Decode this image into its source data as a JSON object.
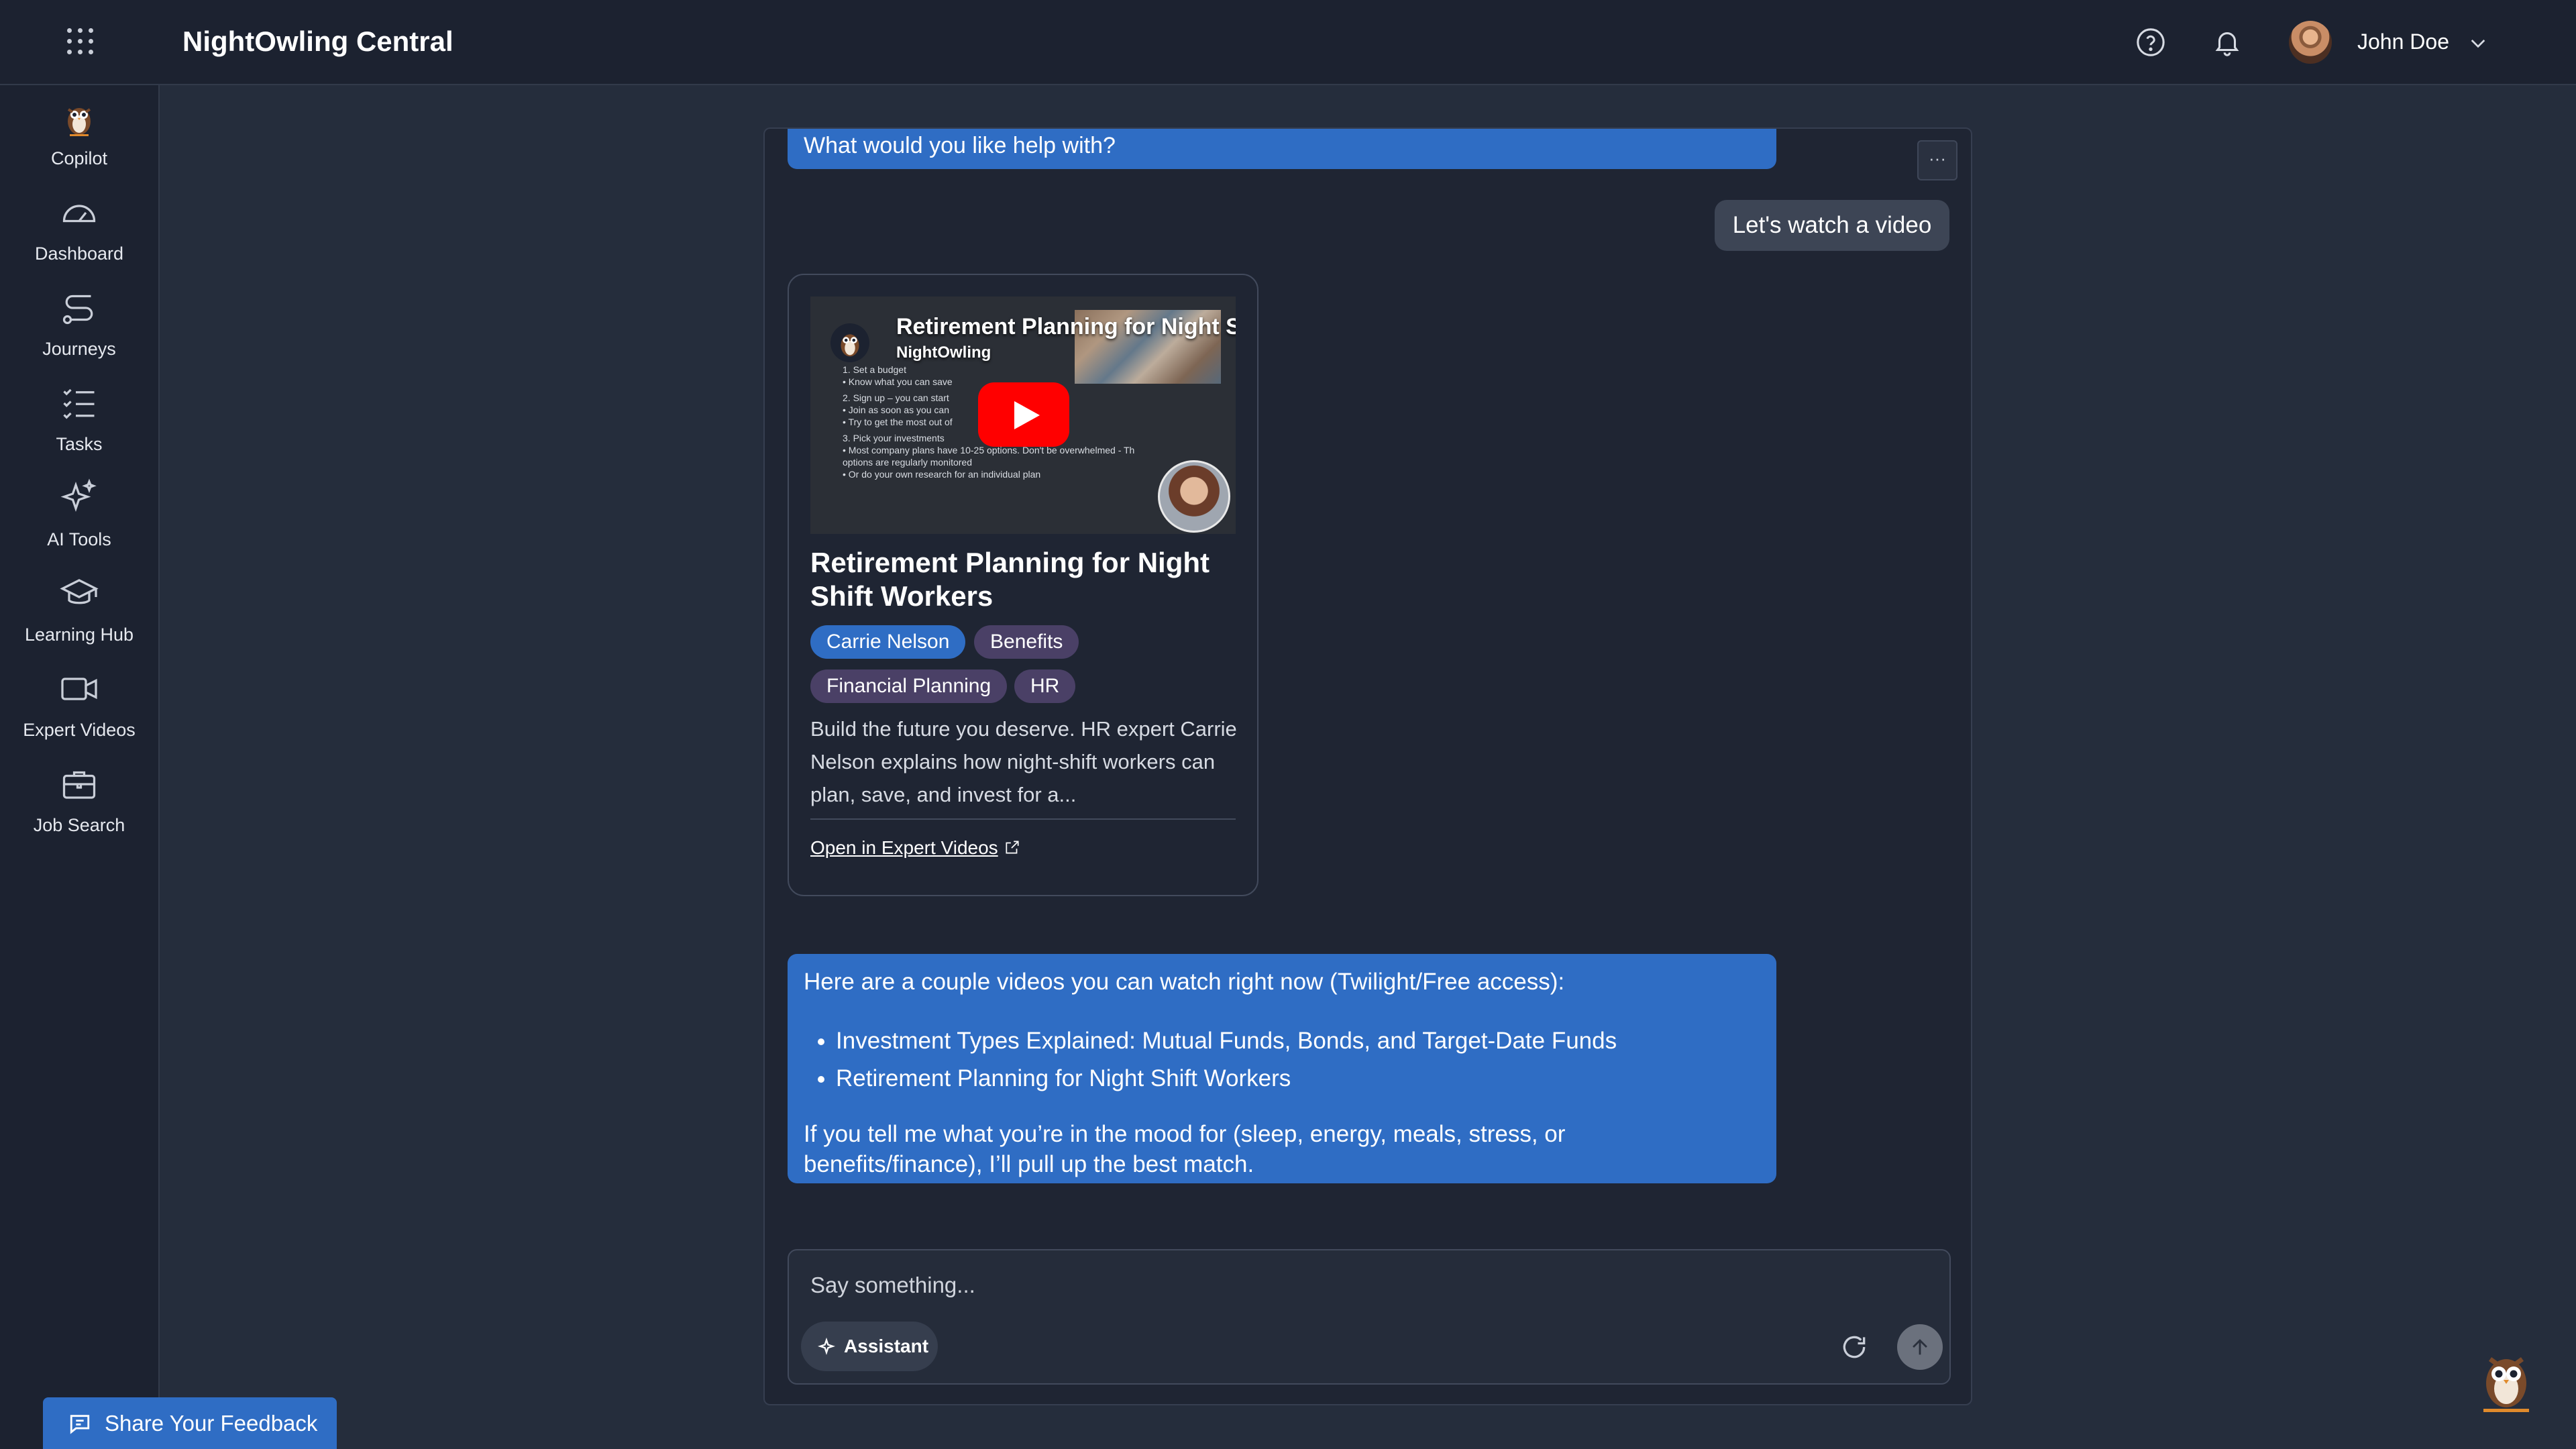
{
  "header": {
    "app_title": "NightOwling Central",
    "user_name": "John Doe"
  },
  "sidebar": {
    "items": [
      {
        "label": "Copilot",
        "icon": "owl-icon"
      },
      {
        "label": "Dashboard",
        "icon": "gauge-icon"
      },
      {
        "label": "Journeys",
        "icon": "route-icon"
      },
      {
        "label": "Tasks",
        "icon": "checklist-icon"
      },
      {
        "label": "AI Tools",
        "icon": "sparkle-icon"
      },
      {
        "label": "Learning Hub",
        "icon": "graduation-cap-icon"
      },
      {
        "label": "Expert Videos",
        "icon": "video-camera-icon"
      },
      {
        "label": "Job Search",
        "icon": "briefcase-icon"
      }
    ]
  },
  "chat": {
    "greeting": "What would you like help with?",
    "more_label": "···",
    "user_message": "Let's watch a video",
    "video_card": {
      "thumb_title": "Retirement Planning for Night Shift Workers",
      "thumb_channel": "NightOwling",
      "slide_lines": [
        "1.  Set a budget",
        "      • Know what you can save",
        "2. Sign up – you can start",
        "      • Join as soon as you can",
        "      • Try to get the most out of",
        "3. Pick your investments",
        "      • Most company plans have 10-25 options. Don't be overwhelmed - Th",
        "         options are regularly monitored",
        "      • Or do your own research for an individual plan"
      ],
      "title": "Retirement Planning for Night Shift Workers",
      "tags": [
        "Carrie Nelson",
        "Benefits",
        "Financial Planning",
        "HR"
      ],
      "description": "Build the future you deserve. HR expert Carrie Nelson explains how night-shift workers can plan, save, and invest for a...",
      "open_link": "Open in Expert Videos"
    },
    "bot_answer": {
      "intro": "Here are a couple videos you can watch right now (Twilight/Free access):",
      "items": [
        "Investment Types Explained: Mutual Funds, Bonds, and Target-Date Funds",
        "Retirement Planning for Night Shift Workers"
      ],
      "outro": "If you tell me what you’re in the mood for (sleep, energy, meals, stress, or benefits/finance), I’ll pull up the best match."
    }
  },
  "composer": {
    "placeholder": "Say something...",
    "value": "",
    "assistant_label": "Assistant"
  },
  "feedback": {
    "label": "Share Your Feedback"
  },
  "colors": {
    "accent": "#2f6dc4",
    "background": "#252d3c",
    "panel": "#1f2533",
    "secondary_tag": "#4a4066",
    "youtube_red": "#ff0000"
  }
}
